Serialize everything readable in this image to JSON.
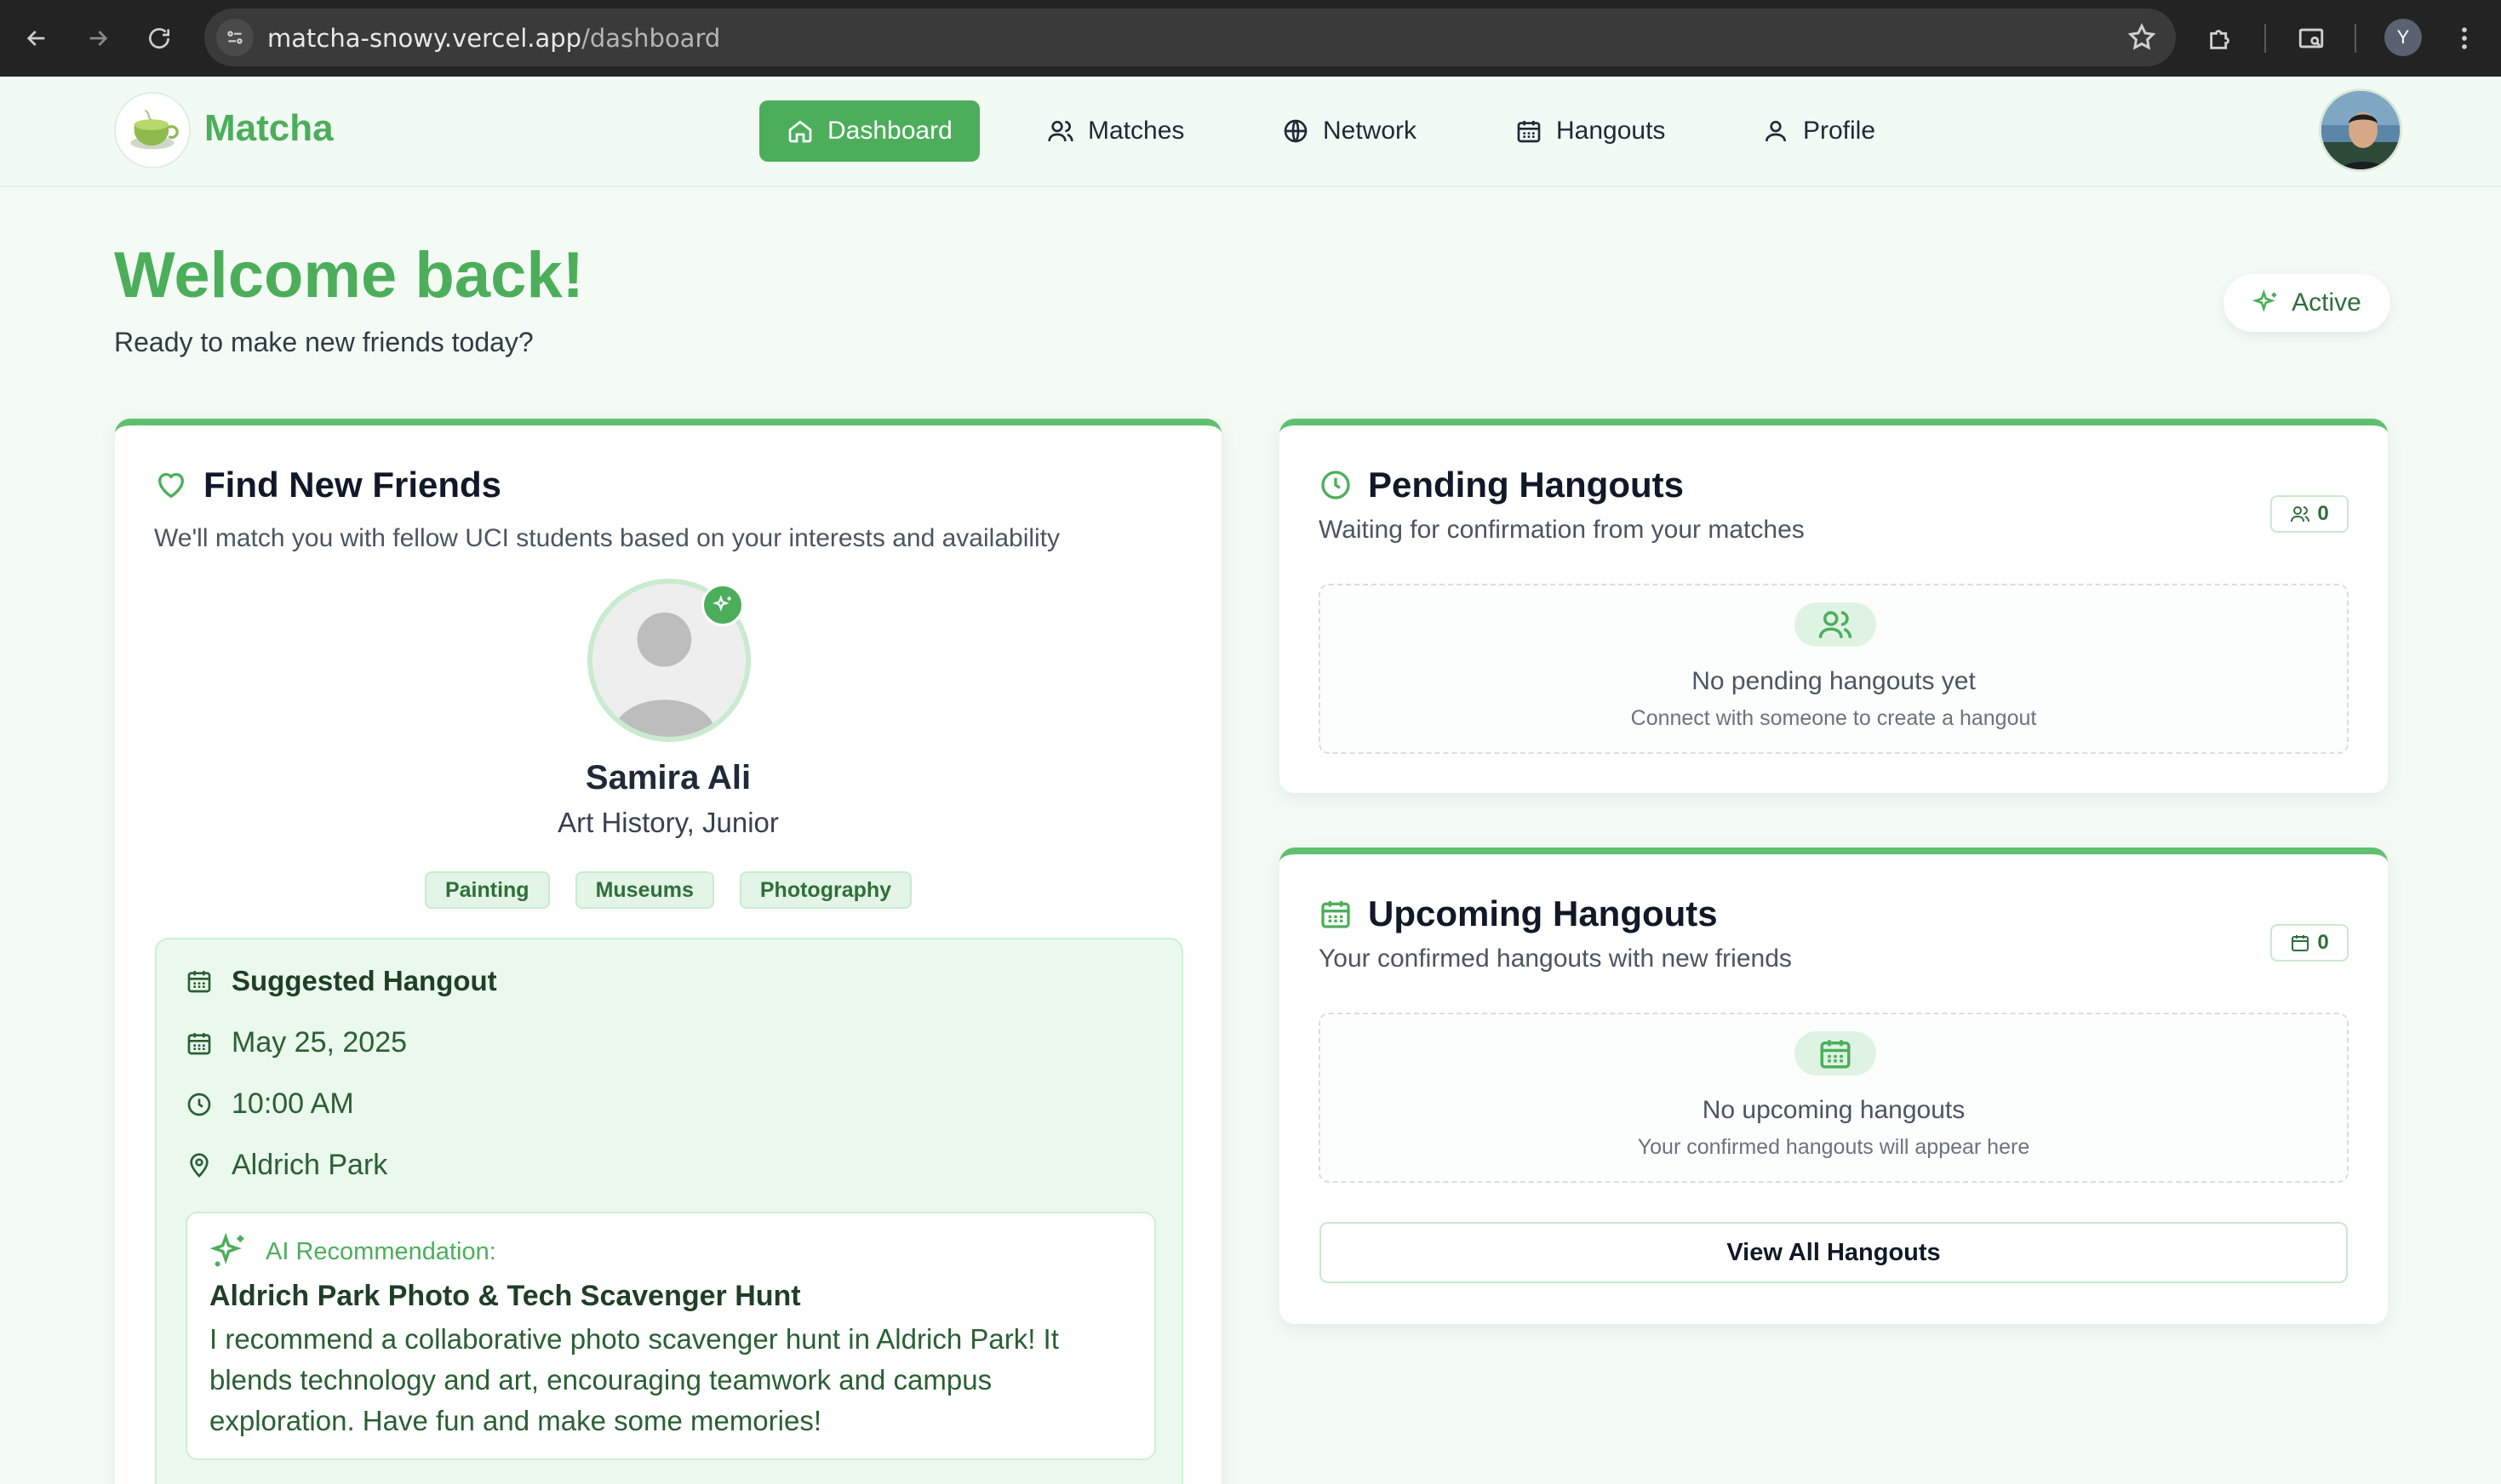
{
  "browser": {
    "url_host": "matcha-snowy.vercel.app",
    "url_path": "/dashboard",
    "profile_initial": "Y"
  },
  "header": {
    "brand": "Matcha",
    "nav": [
      {
        "label": "Dashboard",
        "icon": "home-icon",
        "active": true
      },
      {
        "label": "Matches",
        "icon": "users-icon",
        "active": false
      },
      {
        "label": "Network",
        "icon": "globe-icon",
        "active": false
      },
      {
        "label": "Hangouts",
        "icon": "calendar-icon",
        "active": false
      },
      {
        "label": "Profile",
        "icon": "user-icon",
        "active": false
      }
    ]
  },
  "welcome": {
    "title": "Welcome back!",
    "subtitle": "Ready to make new friends today?",
    "status": "Active"
  },
  "find_friends": {
    "title": "Find New Friends",
    "subtitle": "We'll match you with fellow UCI students based on your interests and availability",
    "person": {
      "name": "Samira Ali",
      "major": "Art History, Junior",
      "tags": [
        "Painting",
        "Museums",
        "Photography"
      ]
    },
    "hangout": {
      "title": "Suggested Hangout",
      "date": "May 25, 2025",
      "time": "10:00 AM",
      "location": "Aldrich Park",
      "ai_label": "AI Recommendation:",
      "ai_title": "Aldrich Park Photo & Tech Scavenger Hunt",
      "ai_description": "I recommend a collaborative photo scavenger hunt in Aldrich Park! It blends technology and art, encouraging teamwork and campus exploration. Have fun and make some memories!"
    }
  },
  "pending": {
    "title": "Pending Hangouts",
    "subtitle": "Waiting for confirmation from your matches",
    "count": "0",
    "empty_title": "No pending hangouts yet",
    "empty_subtitle": "Connect with someone to create a hangout"
  },
  "upcoming": {
    "title": "Upcoming Hangouts",
    "subtitle": "Your confirmed hangouts with new friends",
    "count": "0",
    "empty_title": "No upcoming hangouts",
    "empty_subtitle": "Your confirmed hangouts will appear here",
    "button": "View All Hangouts"
  },
  "colors": {
    "accent": "#4cae5b",
    "accent_light": "#e3f5e6",
    "text_dark": "#1f2937"
  }
}
